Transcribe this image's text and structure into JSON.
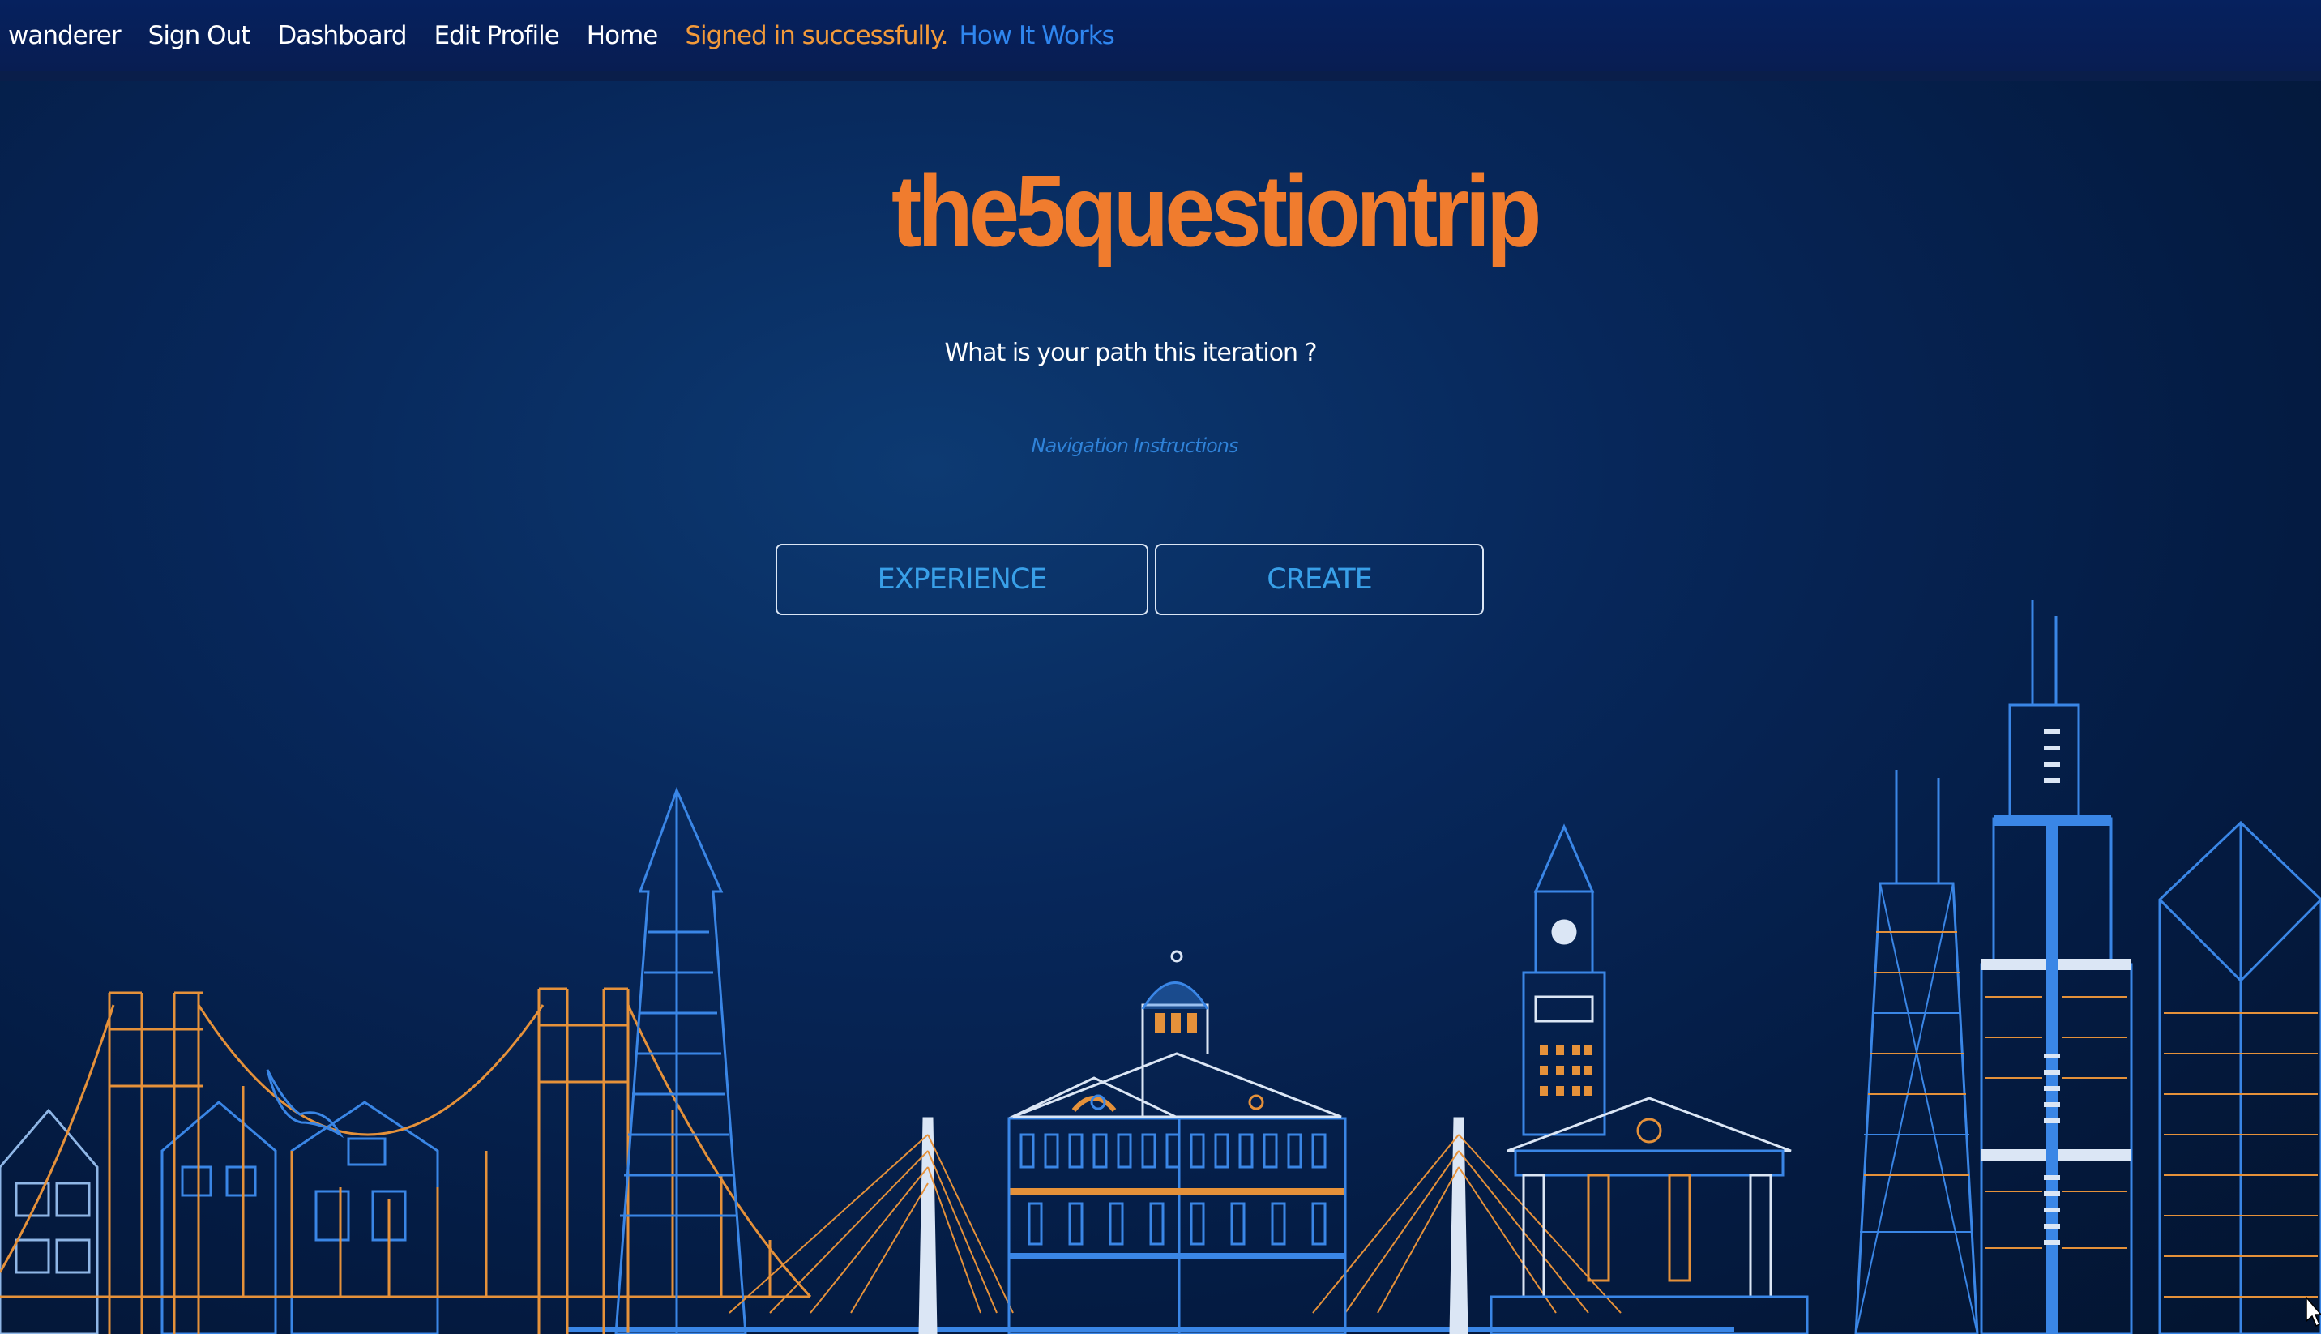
{
  "nav": {
    "username": "wanderer",
    "sign_out": "Sign Out",
    "dashboard": "Dashboard",
    "edit_profile": "Edit Profile",
    "home": "Home",
    "flash_message": "Signed in successfully.",
    "how_it_works": "How It Works"
  },
  "hero": {
    "brand": "the5questiontrip",
    "question": "What is your path this iteration ?",
    "navigation_instructions": "Navigation Instructions"
  },
  "actions": {
    "experience": "EXPERIENCE",
    "create": "CREATE"
  },
  "illustration": {
    "icon": "city-skyline-illustration"
  },
  "colors": {
    "background": "#06275a",
    "navbar": "#07205a",
    "brand": "#f07c2e",
    "flash": "#f39a3a",
    "link_blue": "#2f86ef",
    "button_text": "#39a0e8",
    "skyline_orange": "#e5913a",
    "skyline_blue": "#3a86e6"
  }
}
